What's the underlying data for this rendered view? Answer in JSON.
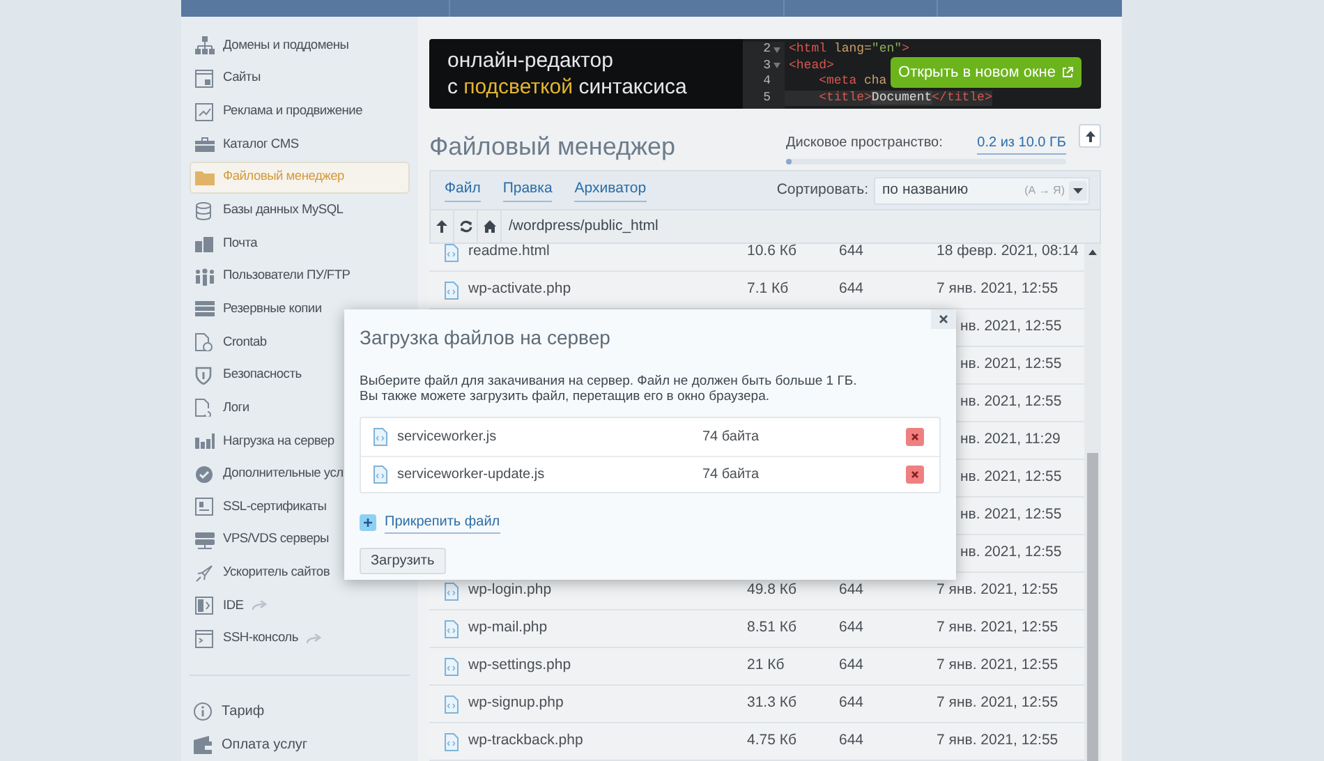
{
  "sidebar": {
    "items": [
      {
        "label": "Домены и поддомены",
        "selected": false,
        "external": false
      },
      {
        "label": "Сайты",
        "selected": false,
        "external": false
      },
      {
        "label": "Реклама и продвижение",
        "selected": false,
        "external": false
      },
      {
        "label": "Каталог CMS",
        "selected": false,
        "external": false
      },
      {
        "label": "Файловый менеджер",
        "selected": true,
        "external": false
      },
      {
        "label": "Базы данных MySQL",
        "selected": false,
        "external": false
      },
      {
        "label": "Почта",
        "selected": false,
        "external": false
      },
      {
        "label": "Пользователи ПУ/FTP",
        "selected": false,
        "external": false
      },
      {
        "label": "Резервные копии",
        "selected": false,
        "external": false
      },
      {
        "label": "Crontab",
        "selected": false,
        "external": false
      },
      {
        "label": "Безопасность",
        "selected": false,
        "external": false
      },
      {
        "label": "Логи",
        "selected": false,
        "external": false
      },
      {
        "label": "Нагрузка на сервер",
        "selected": false,
        "external": false
      },
      {
        "label": "Дополнительные усл",
        "selected": false,
        "external": false
      },
      {
        "label": "SSL-сертификаты",
        "selected": false,
        "external": false
      },
      {
        "label": "VPS/VDS серверы",
        "selected": false,
        "external": false
      },
      {
        "label": "Ускоритель сайтов",
        "selected": false,
        "external": false
      },
      {
        "label": "IDE",
        "selected": false,
        "external": true
      },
      {
        "label": "SSH-консоль",
        "selected": false,
        "external": true
      }
    ],
    "footer_items": [
      {
        "label": "Тариф",
        "selected": false
      },
      {
        "label": "Оплата услуг",
        "selected": false
      }
    ]
  },
  "banner": {
    "line_1": "онлайн-редактор",
    "line_2_start": "с",
    "line_2_highlight": "подсветкой",
    "line_2_end": "синтаксиса",
    "code_lines": [
      {
        "number": "2",
        "fold": true,
        "active": false,
        "tokens": [
          {
            "kind": "tag",
            "text": "<html"
          },
          {
            "kind": "attr",
            "text": " lang="
          },
          {
            "kind": "string",
            "text": "\"en\""
          },
          {
            "kind": "tag",
            "text": ">"
          }
        ]
      },
      {
        "number": "3",
        "fold": true,
        "active": false,
        "tokens": [
          {
            "kind": "tag",
            "text": "<head>"
          }
        ]
      },
      {
        "number": "4",
        "fold": false,
        "active": false,
        "tokens": [
          {
            "kind": "tag",
            "text": "    <meta"
          },
          {
            "kind": "attr",
            "text": " cha"
          }
        ]
      },
      {
        "number": "5",
        "fold": false,
        "active": true,
        "tokens": [
          {
            "kind": "tag",
            "text": "    <title>"
          },
          {
            "kind": "text",
            "text": "Document"
          },
          {
            "kind": "tag",
            "text": "</title>"
          }
        ]
      }
    ],
    "button": "Открыть в новом окне"
  },
  "title": "Файловый менеджер",
  "disk": {
    "label": "Дисковое пространство:",
    "value": "0.2 из 10.0 ГБ",
    "level": 0.02
  },
  "toolbar": {
    "menus": [
      "Файл",
      "Правка",
      "Архиватор"
    ],
    "sort_label": "Сортировать:",
    "sort_value": "по названию",
    "sort_order": "(А → Я)"
  },
  "path": "/wordpress/public_html",
  "files": [
    {
      "name": "readme.html",
      "size": "10.6 Кб",
      "permissions": "644",
      "modified": "18 февр. 2021, 08:14"
    },
    {
      "name": "wp-activate.php",
      "size": "7.1 Кб",
      "permissions": "644",
      "modified": "7 янв. 2021, 12:55"
    },
    {
      "modified": "нв. 2021, 12:55"
    },
    {
      "modified": "нв. 2021, 12:55"
    },
    {
      "modified": "нв. 2021, 12:55"
    },
    {
      "modified": "нв. 2021, 11:29"
    },
    {
      "modified": "нв. 2021, 12:55"
    },
    {
      "modified": "нв. 2021, 12:55"
    },
    {
      "modified": "нв. 2021, 12:55"
    },
    {
      "name": "wp-login.php",
      "size": "49.8 Кб",
      "permissions": "644",
      "modified": "7 янв. 2021, 12:55"
    },
    {
      "name": "wp-mail.php",
      "size": "8.51 Кб",
      "permissions": "644",
      "modified": "7 янв. 2021, 12:55"
    },
    {
      "name": "wp-settings.php",
      "size": "21 Кб",
      "permissions": "644",
      "modified": "7 янв. 2021, 12:55"
    },
    {
      "name": "wp-signup.php",
      "size": "31.3 Кб",
      "permissions": "644",
      "modified": "7 янв. 2021, 12:55"
    },
    {
      "name": "wp-trackback.php",
      "size": "4.75 Кб",
      "permissions": "644",
      "modified": "7 янв. 2021, 12:55"
    }
  ],
  "dialog": {
    "title": "Загрузка файлов на сервер",
    "description": [
      "Выберите файл для закачивания на сервер. Файл не должен быть больше 1 ГБ.",
      "Вы также можете загрузить файл, перетащив его в окно браузера."
    ],
    "files": [
      {
        "name": "serviceworker.js",
        "size": "74 байта"
      },
      {
        "name": "serviceworker-update.js",
        "size": "74 байта"
      }
    ],
    "attach_link": "Прикрепить файл",
    "upload_button": "Загрузить"
  }
}
